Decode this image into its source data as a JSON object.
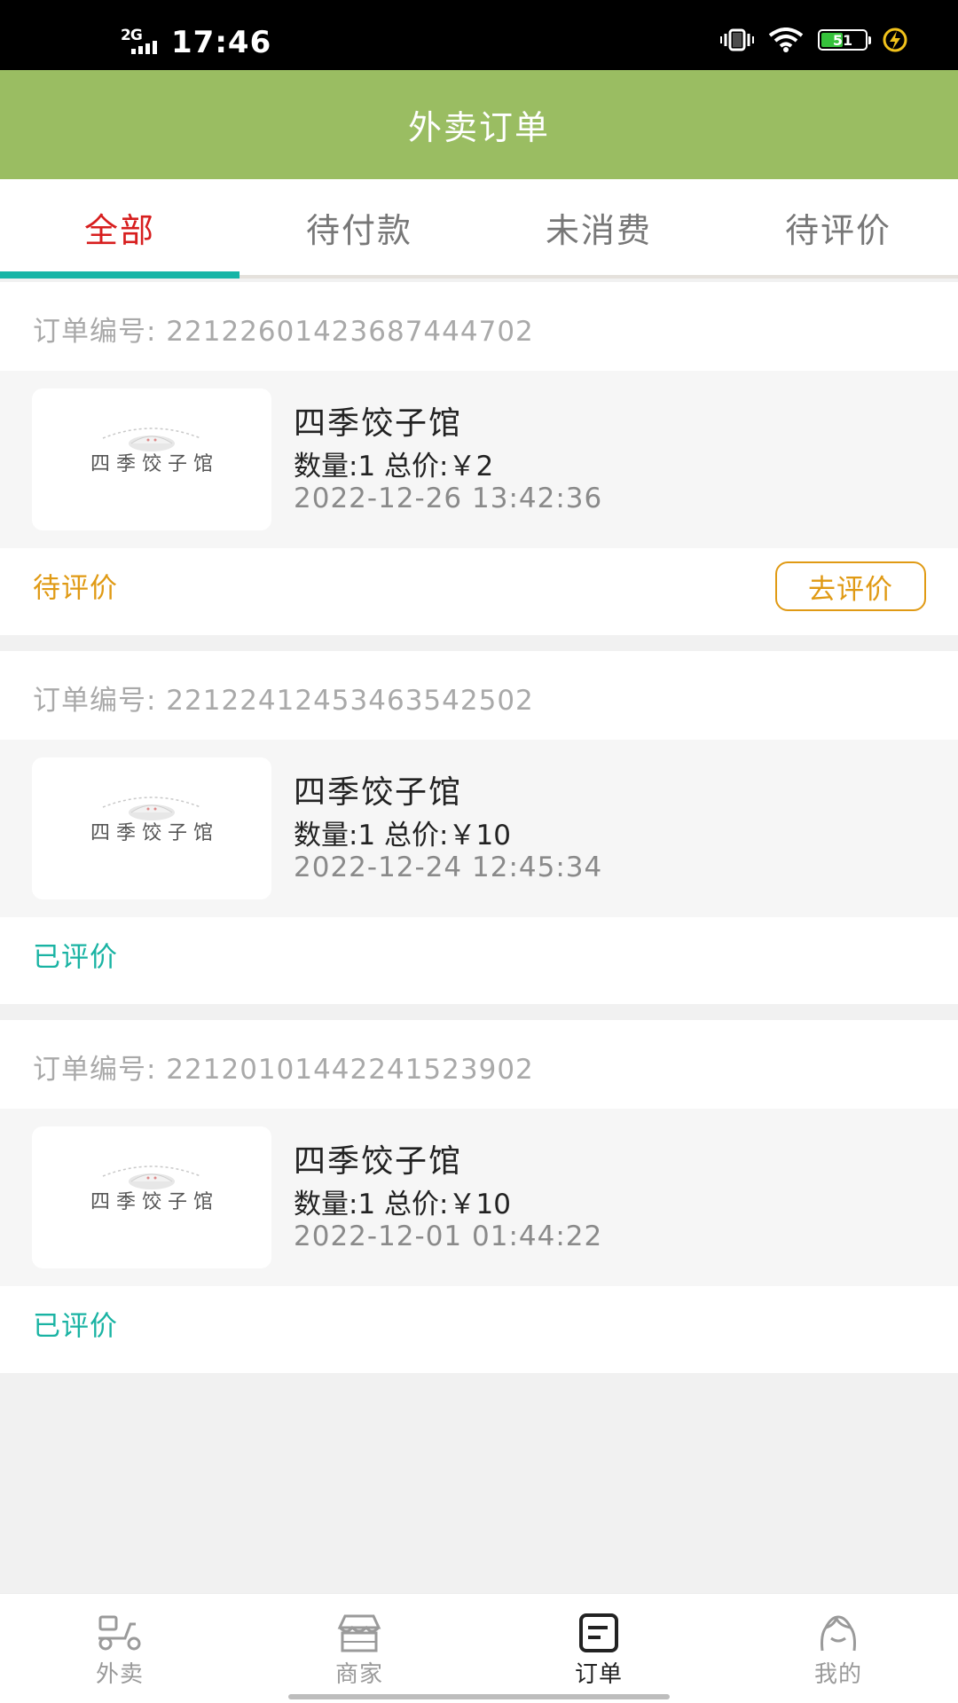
{
  "status_bar": {
    "network": "2G",
    "time": "17:46",
    "battery": "51",
    "battery_level": 0.51,
    "icons": [
      "vibrate-icon",
      "wifi-icon",
      "battery-icon",
      "charging-icon"
    ]
  },
  "header": {
    "title": "外卖订单"
  },
  "tabs": [
    {
      "label": "全部",
      "active": true
    },
    {
      "label": "待付款",
      "active": false
    },
    {
      "label": "未消费",
      "active": false
    },
    {
      "label": "待评价",
      "active": false
    }
  ],
  "orders": [
    {
      "order_no": "订单编号: 2212260142368744470​2",
      "shop": "四季饺子馆",
      "qty_price": "数量:1   总价:￥2",
      "time": "2022-12-26 13:42:36",
      "status": "待评价",
      "action": "去评价"
    },
    {
      "order_no": "订单编号: 2212241245346354250​2",
      "shop": "四季饺子馆",
      "qty_price": "数量:1   总价:￥10",
      "time": "2022-12-24 12:45:34",
      "status": "已评价",
      "action": ""
    },
    {
      "order_no": "订单编号: 2212010144224152390​2",
      "shop": "四季饺子馆",
      "qty_price": "数量:1   总价:￥10",
      "time": "2022-12-01 01:44:22",
      "status": "已评价",
      "action": ""
    }
  ],
  "shop_logo_text": "四 季 饺 子 馆",
  "bottom_nav": [
    {
      "label": "外卖",
      "icon": "scooter-icon",
      "active": false
    },
    {
      "label": "商家",
      "icon": "store-icon",
      "active": false
    },
    {
      "label": "订单",
      "icon": "order-icon",
      "active": true
    },
    {
      "label": "我的",
      "icon": "profile-icon",
      "active": false
    }
  ],
  "colors": {
    "header_bg": "#9abd62",
    "tab_active": "#d71e1e",
    "tab_underline": "#17b5a6",
    "status_pending": "#e09a14",
    "status_done": "#19b3a3"
  }
}
